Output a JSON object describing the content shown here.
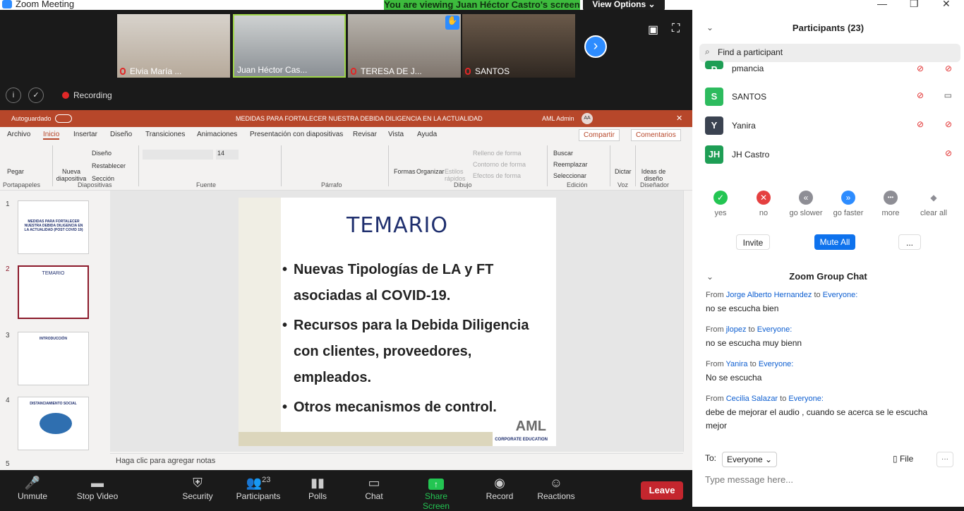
{
  "window": {
    "title": "Zoom Meeting"
  },
  "banner": {
    "viewing": "You are viewing Juan Héctor Castro's screen",
    "view_options": "View Options"
  },
  "thumbnails": [
    {
      "name": "Elvia María ...",
      "muted": true
    },
    {
      "name": "Juan Héctor Cas...",
      "muted": false,
      "active": true
    },
    {
      "name": "TERESA DE J...",
      "muted": true,
      "hand": true
    },
    {
      "name": "SANTOS",
      "muted": true
    }
  ],
  "info": {
    "recording": "Recording"
  },
  "ppt": {
    "autosave": "Autoguardado",
    "doc_title": "MEDIDAS PARA FORTALECER NUESTRA DEBIDA DILIGENCIA EN LA ACTUALIDAD",
    "user": "AML Admin",
    "user_initials": "AA",
    "tabs": [
      "Archivo",
      "Inicio",
      "Insertar",
      "Diseño",
      "Transiciones",
      "Animaciones",
      "Presentación con diapositivas",
      "Revisar",
      "Vista",
      "Ayuda"
    ],
    "share": "Compartir",
    "comments": "Comentarios",
    "ribbon": {
      "paste": "Pegar",
      "portapapeles": "Portapapeles",
      "new_slide": "Nueva diapositiva",
      "diseno": "Diseño",
      "restablecer": "Restablecer",
      "seccion": "Sección",
      "diapositivas": "Diapositivas",
      "font_size": "14",
      "fuente": "Fuente",
      "parrafo": "Párrafo",
      "formas": "Formas",
      "organizar": "Organizar",
      "estilos": "Estilos rápidos",
      "relleno": "Relleno de forma",
      "contorno": "Contorno de forma",
      "efectos": "Efectos de forma",
      "dibujo": "Dibujo",
      "buscar": "Buscar",
      "reemplazar": "Reemplazar",
      "seleccionar": "Seleccionar",
      "edicion": "Edición",
      "dictar": "Dictar",
      "voz": "Voz",
      "ideas": "Ideas de diseño",
      "disenador": "Diseñador"
    },
    "slide_numbers": [
      "1",
      "2",
      "3",
      "4",
      "5"
    ],
    "thumb_titles": [
      "MEDIDAS PARA FORTALECER NUESTRA DEBIDA DILIGENCIA EN LA ACTUALIDAD (POST COVID 19)",
      "TEMARIO",
      "INTRODUCCIÓN",
      "DISTANCIAMIENTO SOCIAL"
    ],
    "slide": {
      "title": "TEMARIO",
      "bullets": [
        "Nuevas Tipologías de LA y FT asociadas al COVID-19.",
        "Recursos para la Debida Diligencia con clientes, proveedores, empleados.",
        "Otros mecanismos de control."
      ],
      "logo": "AML",
      "logo_sub": "CORPORATE EDUCATION"
    },
    "notes": "Haga clic para agregar notas"
  },
  "bottom": {
    "unmute": "Unmute",
    "stop_video": "Stop Video",
    "security": "Security",
    "participants": "Participants",
    "participants_count": "23",
    "polls": "Polls",
    "chat": "Chat",
    "share_screen": "Share Screen",
    "record": "Record",
    "reactions": "Reactions",
    "leave": "Leave"
  },
  "panel": {
    "title": "Participants (23)",
    "search": "Find a participant",
    "participants": [
      {
        "initial": "P",
        "name": "pmancia",
        "color": "#1e9e55"
      },
      {
        "initial": "S",
        "name": "SANTOS",
        "color": "#2dbb5e"
      },
      {
        "initial": "Y",
        "name": "Yanira",
        "color": "#3b4351"
      },
      {
        "initial": "JH",
        "name": "JH Castro",
        "color": "#1e9e55"
      }
    ],
    "reactions": [
      {
        "label": "yes",
        "color": "#23c552",
        "symbol": "✓"
      },
      {
        "label": "no",
        "color": "#e54040",
        "symbol": "✕"
      },
      {
        "label": "go slower",
        "color": "#8e8e95",
        "symbol": "«"
      },
      {
        "label": "go faster",
        "color": "#2d8cff",
        "symbol": "»"
      },
      {
        "label": "more",
        "color": "#8e8e95",
        "symbol": "•••"
      },
      {
        "label": "clear all",
        "color": "#8e8e95",
        "symbol": "◆"
      }
    ],
    "invite": "Invite",
    "mute_all": "Mute All",
    "more": "...",
    "chat_title": "Zoom Group Chat",
    "messages": [
      {
        "from_prefix": "From",
        "from": "Jorge Alberto Hernandez",
        "to_prefix": "to",
        "to": "Everyone:",
        "text": "no se escucha bien"
      },
      {
        "from_prefix": "From",
        "from": "jlopez",
        "to_prefix": "to",
        "to": "Everyone:",
        "text": "no se escucha muy bienn"
      },
      {
        "from_prefix": "From",
        "from": "Yanira",
        "to_prefix": "to",
        "to": "Everyone:",
        "text": "No se escucha"
      },
      {
        "from_prefix": "From",
        "from": "Cecilia Salazar",
        "to_prefix": "to",
        "to": "Everyone:",
        "text": "debe de mejorar el audio , cuando se acerca se le escucha mejor"
      }
    ],
    "to_label": "To:",
    "to_value": "Everyone",
    "file": "File",
    "placeholder": "Type message here..."
  }
}
